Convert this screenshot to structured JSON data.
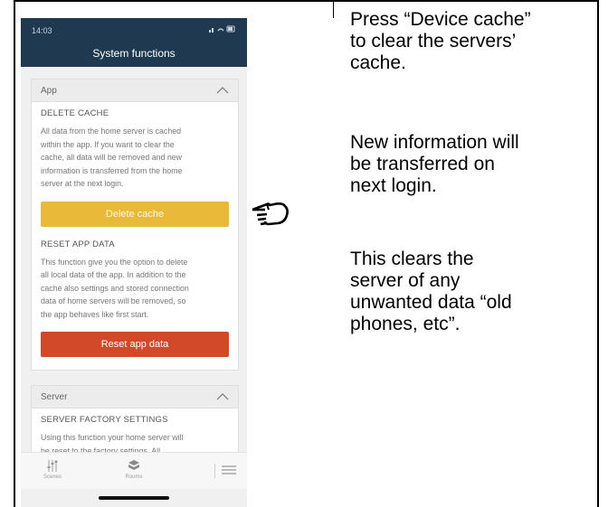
{
  "phone": {
    "status_time": "14:03",
    "header_title": "System functions",
    "app_section": {
      "heading": "App",
      "delete_cache": {
        "title": "DELETE CACHE",
        "lines": [
          "All data from the home server is cached",
          "within the app. If you want to clear the",
          "cache, all data will be removed and new",
          "information is transferred from the home",
          "server at the next login."
        ],
        "button_label": "Delete cache"
      },
      "reset_app_data": {
        "title": "RESET APP DATA",
        "lines": [
          "This function give you the option to delete",
          "all local data of the app. In addition to the",
          "cache also settings and stored connection",
          "data of home servers will be removed, so",
          "the app behaves like first start."
        ],
        "button_label": "Reset app data"
      }
    },
    "server_section": {
      "heading": "Server",
      "factory": {
        "title": "SERVER FACTORY SETTINGS",
        "lines": [
          "Using this function your home server will",
          "be reset to the factory settings. All"
        ]
      }
    },
    "tabbar": {
      "scenes": "Scenes",
      "rooms": "Rooms"
    }
  },
  "instructions": {
    "press": "Press “Device cache”\nto clear the servers’\ncache.",
    "new_info": "New information will\nbe transferred on\nnext login.",
    "clears": "This clears the\nserver of any\nunwanted data “old\nphones, etc”."
  },
  "colors": {
    "header": "#1f3a50",
    "delete_button": "#e9b93a",
    "reset_button": "#d2492a"
  },
  "icons": [
    "pointing-hand-icon",
    "chevron-up-icon",
    "scenes-icon",
    "rooms-icon",
    "menu-icon"
  ]
}
